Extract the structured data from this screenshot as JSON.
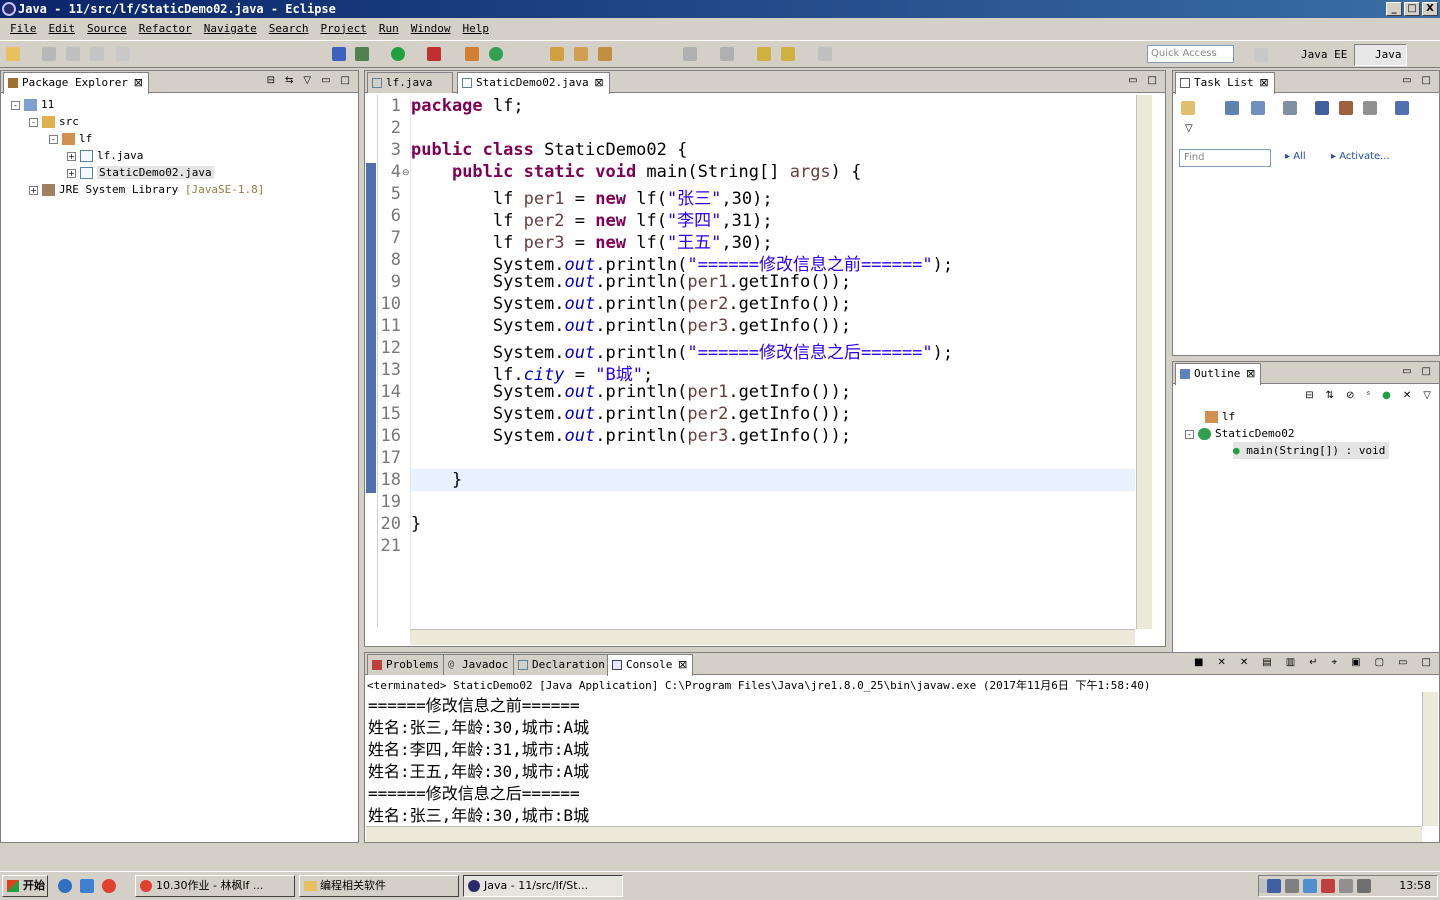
{
  "window": {
    "title": "Java - 11/src/lf/StaticDemo02.java - Eclipse",
    "btn_min": "_",
    "btn_max": "□",
    "btn_close": "X"
  },
  "menu": [
    "File",
    "Edit",
    "Source",
    "Refactor",
    "Navigate",
    "Search",
    "Project",
    "Run",
    "Window",
    "Help"
  ],
  "toolbar": {
    "quick_access_placeholder": "Quick Access",
    "perspective_javaee": "Java EE",
    "perspective_java": "Java"
  },
  "package_explorer": {
    "tab": "Package Explorer",
    "project": "11",
    "src": "src",
    "package": "lf",
    "file1": "lf.java",
    "file2": "StaticDemo02.java",
    "jre": "JRE System Library",
    "jre_version": "[JavaSE-1.8]"
  },
  "editor": {
    "tab1": "lf.java",
    "tab2": "StaticDemo02.java",
    "line_numbers": [
      "1",
      "2",
      "3",
      "4",
      "5",
      "6",
      "7",
      "8",
      "9",
      "10",
      "11",
      "12",
      "13",
      "14",
      "15",
      "16",
      "17",
      "18",
      "19",
      "20",
      "21"
    ],
    "l1_kw": "package",
    "l1_rest": " lf;",
    "l3_kw": "public class",
    "l3_rest": " StaticDemo02 {",
    "l4_indent": "    ",
    "l4_kw": "public static void",
    "l4_mid": " main(String[] ",
    "l4_var": "args",
    "l4_end": ") {",
    "l5_pre": "        lf ",
    "l5_var": "per1",
    "l5_eq": " = ",
    "l5_kw": "new",
    "l5_call": " lf(",
    "l5_str": "\"张三\"",
    "l5_end": ",30);",
    "l6_pre": "        lf ",
    "l6_var": "per2",
    "l6_eq": " = ",
    "l6_kw": "new",
    "l6_call": " lf(",
    "l6_str": "\"李四\"",
    "l6_end": ",31);",
    "l7_pre": "        lf ",
    "l7_var": "per3",
    "l7_eq": " = ",
    "l7_kw": "new",
    "l7_call": " lf(",
    "l7_str": "\"王五\"",
    "l7_end": ",30);",
    "sys": "        System.",
    "out": "out",
    "println": ".println(",
    "l8_str": "\"======修改信息之前======\"",
    "close_semi": ");",
    "per1": "per1",
    "per2": "per2",
    "per3": "per3",
    "getinfo": ".getInfo());",
    "l12_str": "\"======修改信息之后======\"",
    "l13_pre": "        lf.",
    "l13_fld": "city",
    "l13_eq": " = ",
    "l13_str": "\"B城\"",
    "l13_end": ";",
    "l18": "    }",
    "l20": "}"
  },
  "task_list": {
    "tab": "Task List",
    "find_placeholder": "Find",
    "all": "All",
    "activate": "Activate..."
  },
  "outline": {
    "tab": "Outline",
    "pkg": "lf",
    "cls": "StaticDemo02",
    "method": "main(String[]) : void"
  },
  "bottom_tabs": {
    "problems": "Problems",
    "javadoc": "Javadoc",
    "declaration": "Declaration",
    "console": "Console"
  },
  "console": {
    "status": "<terminated> StaticDemo02 [Java Application] C:\\Program Files\\Java\\jre1.8.0_25\\bin\\javaw.exe (2017年11月6日 下午1:58:40)",
    "lines": [
      "======修改信息之前======",
      "姓名:张三,年龄:30,城市:A城",
      "姓名:李四,年龄:31,城市:A城",
      "姓名:王五,年龄:30,城市:A城",
      "======修改信息之后======",
      "姓名:张三,年龄:30,城市:B城"
    ]
  },
  "taskbar": {
    "start": "开始",
    "item1": "10.30作业 - 林枫lf ...",
    "item2": "编程相关软件",
    "item3": "Java - 11/src/lf/St...",
    "clock": "13:58"
  },
  "colors": {
    "keyword": "#7f0055",
    "string": "#2a00ff",
    "field": "#0000c0",
    "variable": "#6a3e3e",
    "title_bar": "#0a246a"
  }
}
